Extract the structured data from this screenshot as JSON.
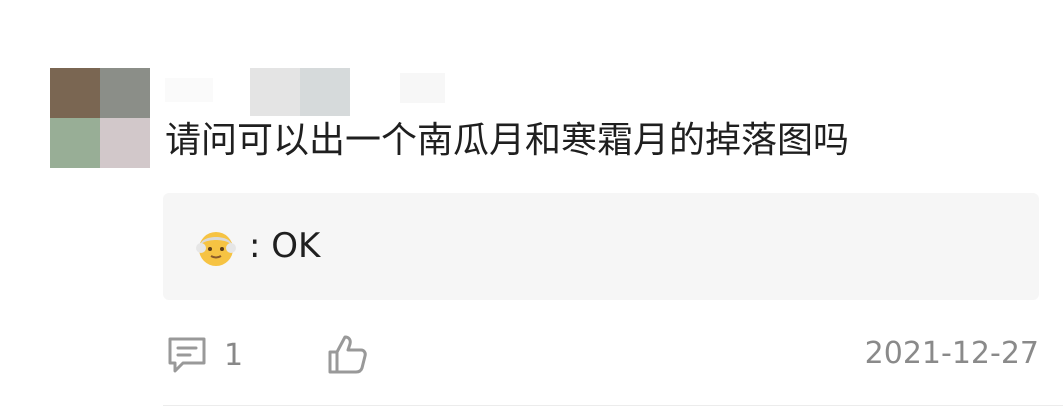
{
  "comment": {
    "text": "请问可以出一个南瓜月和寒霜月的掉落图吗",
    "reply": {
      "emoji": "older-man-emoji",
      "text": ": OK"
    },
    "reply_count": "1",
    "date": "2021-12-27"
  },
  "icons": {
    "reply": "comment-bubble-icon",
    "like": "thumbs-up-icon"
  },
  "colors": {
    "reply_background": "#f6f6f6",
    "meta_text": "#888888",
    "icon_stroke": "#999999"
  }
}
